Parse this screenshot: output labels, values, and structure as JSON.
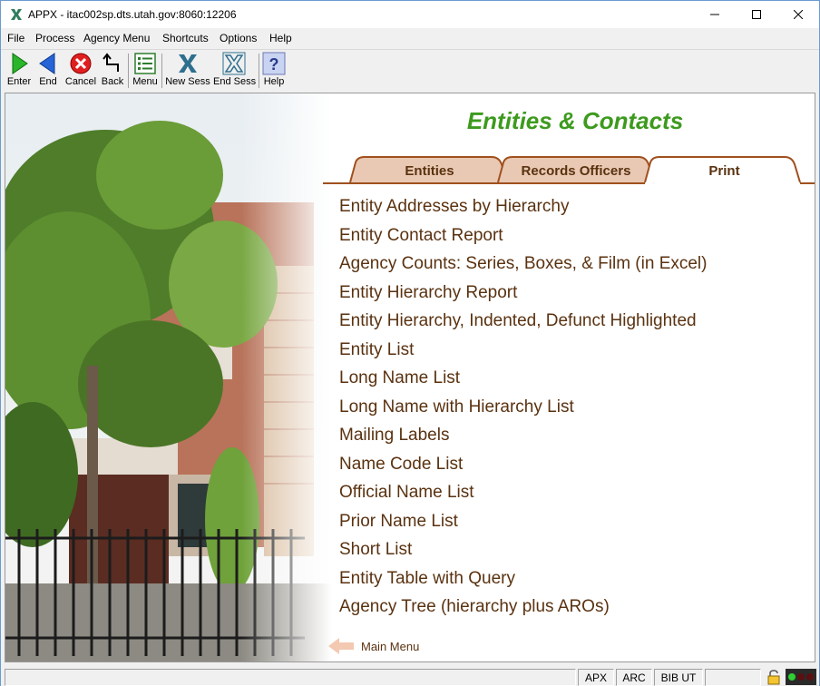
{
  "window": {
    "title": "APPX - itac002sp.dts.utah.gov:8060:12206"
  },
  "menubar": {
    "items": [
      "File",
      "Process",
      "Agency Menu",
      "Shortcuts",
      "Options",
      "Help"
    ]
  },
  "toolbar": {
    "buttons": [
      {
        "label": "Enter",
        "icon": "play-icon"
      },
      {
        "label": "End",
        "icon": "back-arrow-icon"
      },
      {
        "label": "Cancel",
        "icon": "cancel-icon"
      },
      {
        "label": "Back",
        "icon": "back-step-icon"
      },
      {
        "label": "Menu",
        "icon": "menu-list-icon"
      },
      {
        "label": "New Sess",
        "icon": "new-session-icon"
      },
      {
        "label": "End Sess",
        "icon": "end-session-icon"
      },
      {
        "label": "Help",
        "icon": "help-icon"
      }
    ]
  },
  "main": {
    "title": "Entities & Contacts",
    "tabs": [
      {
        "label": "Entities",
        "active": false
      },
      {
        "label": "Records Officers",
        "active": false
      },
      {
        "label": "Print",
        "active": true
      }
    ],
    "reports": [
      "Entity Addresses by Hierarchy",
      "Entity Contact Report",
      "Agency Counts: Series, Boxes, & Film (in Excel)",
      "Entity Hierarchy Report",
      "Entity Hierarchy, Indented, Defunct Highlighted",
      "Entity List",
      "Long Name List",
      "Long Name with Hierarchy List",
      "Mailing Labels",
      "Name Code List",
      "Official Name List",
      "Prior Name List",
      "Short List",
      "Entity Table with Query",
      "Agency Tree (hierarchy plus AROs)"
    ],
    "back_link": "Main Menu"
  },
  "statusbar": {
    "cells": [
      "APX",
      "ARC",
      "BIB UT"
    ]
  },
  "colors": {
    "title_green": "#3d9a1e",
    "text_brown": "#5a3210",
    "tab_fill": "#e9c9b3",
    "tab_border": "#a0501e"
  }
}
